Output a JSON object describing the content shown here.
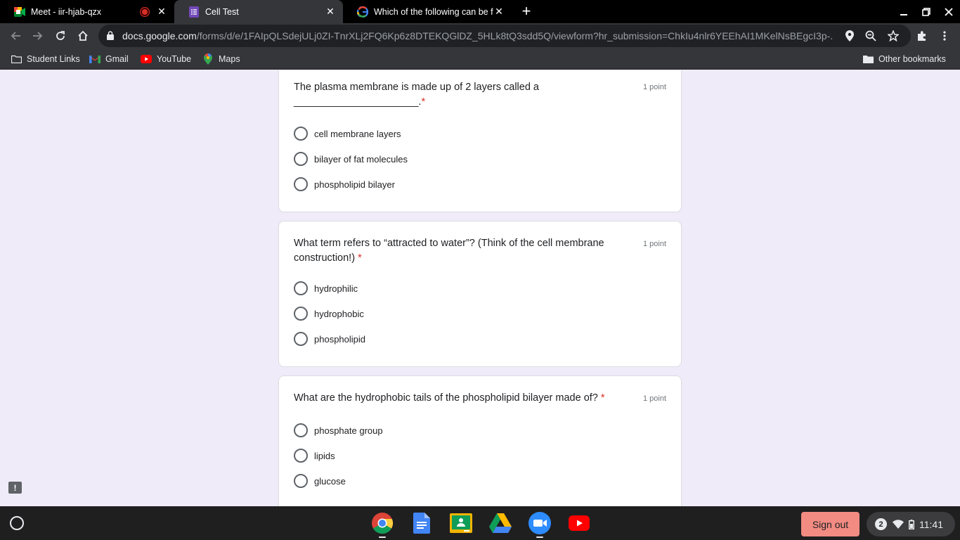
{
  "browser": {
    "tabs": [
      {
        "title": "Meet - iir-hjab-qzx",
        "recording": true,
        "icon": "google-meet-icon"
      },
      {
        "title": "Cell Test",
        "icon": "google-forms-icon",
        "active": true
      },
      {
        "title": "Which of the following can be fo",
        "icon": "google-icon"
      }
    ],
    "url_host": "docs.google.com",
    "url_path": "/forms/d/e/1FAIpQLSdejULj0ZI-TnrXLj2FQ6Kp6z8DTEKQGlDZ_5HLk8tQ3sdd5Q/viewform?hr_submission=ChkIu4nlr6YEEhAI1MKelNsBEgcI3p-..."
  },
  "bookmarks": [
    {
      "label": "Student Links",
      "icon": "folder-icon"
    },
    {
      "label": "Gmail",
      "icon": "gmail-icon"
    },
    {
      "label": "YouTube",
      "icon": "youtube-icon"
    },
    {
      "label": "Maps",
      "icon": "maps-icon"
    }
  ],
  "other_bookmarks": "Other bookmarks",
  "questions": [
    {
      "text_line1": "The plasma membrane is made up of 2 layers called a",
      "text_line2": "______________________.",
      "required_mark": "*",
      "points": "1 point",
      "options": [
        "cell membrane layers",
        "bilayer of fat molecules",
        "phospholipid bilayer"
      ]
    },
    {
      "text_line1": "What term refers to “attracted to water”? (Think of the cell membrane",
      "text_line2": "construction!)",
      "required_mark": "*",
      "points": "1 point",
      "options": [
        "hydrophilic",
        "hydrophobic",
        "phospholipid"
      ]
    },
    {
      "text_line1": "What are the hydrophobic tails of the phospholipid bilayer made of?",
      "required_mark": "*",
      "points": "1 point",
      "options": [
        "phosphate group",
        "lipids",
        "glucose"
      ]
    }
  ],
  "feedback_icon": "!",
  "shelf": {
    "apps": [
      "chrome-icon",
      "google-docs-icon",
      "google-classroom-icon",
      "google-drive-icon",
      "zoom-icon",
      "youtube-icon"
    ],
    "sign_out": "Sign out",
    "notification_count": "2",
    "time": "11:41"
  },
  "colors": {
    "accent": "#673ab7",
    "required": "#d93025",
    "page_bg": "#f0ebf8",
    "sign_out": "#f28b82"
  }
}
